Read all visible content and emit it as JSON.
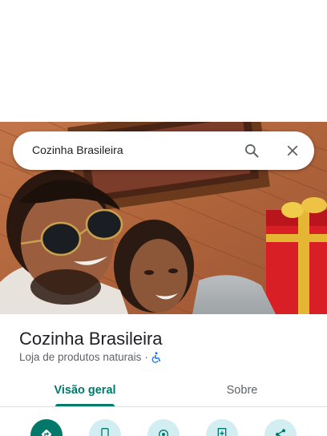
{
  "search": {
    "query": "Cozinha Brasileira"
  },
  "place": {
    "name": "Cozinha Brasileira",
    "category": "Loja de produtos naturais",
    "separator": "·",
    "accessibility_icon": "wheelchair-icon"
  },
  "tabs": [
    {
      "label": "Visão geral",
      "selected": true
    },
    {
      "label": "Sobre",
      "selected": false
    }
  ],
  "actions": [
    {
      "icon": "directions-icon",
      "primary": true
    },
    {
      "icon": "phone-icon",
      "primary": false
    },
    {
      "icon": "location-icon",
      "primary": false
    },
    {
      "icon": "save-icon",
      "primary": false
    },
    {
      "icon": "share-icon",
      "primary": false
    }
  ],
  "colors": {
    "accent": "#00796b",
    "action_bg": "#d2eef3",
    "text": "#202124",
    "muted": "#5f6368"
  }
}
